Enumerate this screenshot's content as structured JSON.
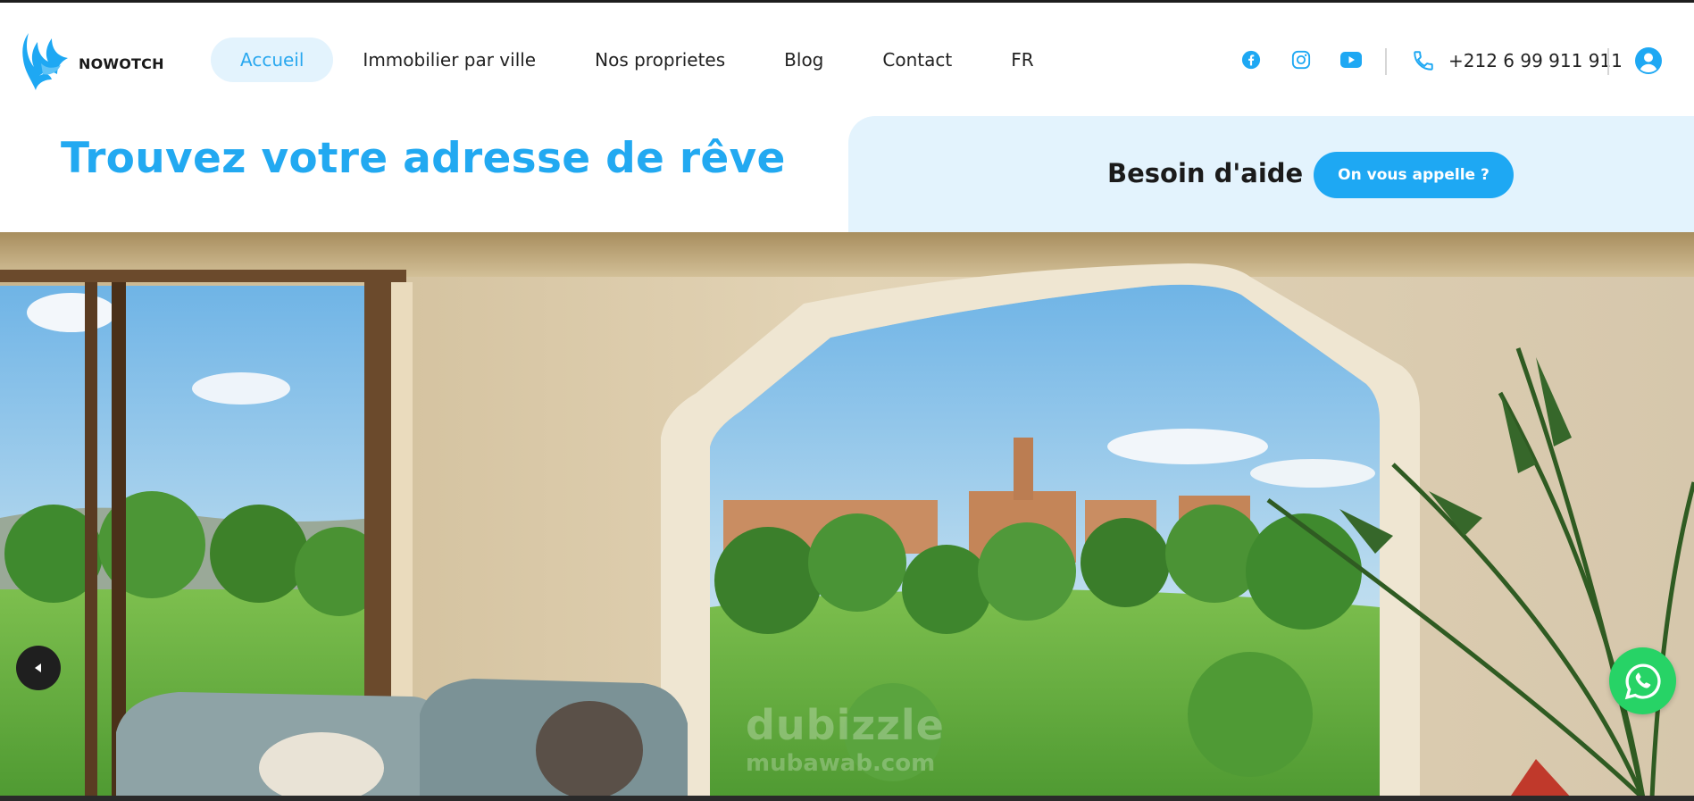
{
  "brand": {
    "name": "NOWOTCH",
    "accent_color": "#22a9f1",
    "logo_icon": "phoenix-logo-icon"
  },
  "nav": {
    "items": [
      {
        "label": "Accueil",
        "active": true
      },
      {
        "label": "Immobilier par ville",
        "active": false
      },
      {
        "label": "Nos proprietes",
        "active": false
      },
      {
        "label": "Blog",
        "active": false
      },
      {
        "label": "Contact",
        "active": false
      },
      {
        "label": "FR",
        "active": false
      }
    ]
  },
  "header": {
    "social_icons": [
      "facebook-icon",
      "instagram-icon",
      "youtube-icon"
    ],
    "phone_icon": "phone-icon",
    "phone": "+212 6 99 911 911",
    "account_icon": "user-circle-icon"
  },
  "hero": {
    "headline": "Trouvez votre adresse de rêve",
    "help_label": "Besoin d'aide",
    "callback_button": "On vous appelle ?",
    "panel_color": "#e3f3fd"
  },
  "banner": {
    "watermark": "dubizzle",
    "watermark_sub": "mubawab.com",
    "prev_icon": "caret-left-icon",
    "whatsapp_icon": "whatsapp-icon",
    "whatsapp_color": "#27d366"
  }
}
